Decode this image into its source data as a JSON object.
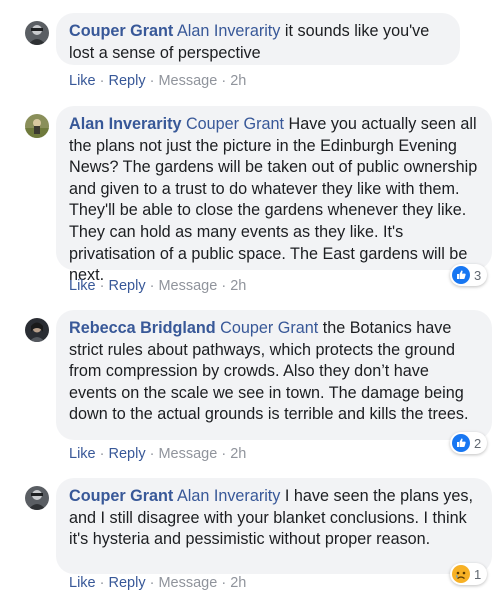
{
  "comments": [
    {
      "author": "Couper Grant",
      "mention": "Alan Inverarity",
      "text": " it sounds like you've lost a sense of perspective",
      "actions": {
        "like": "Like",
        "reply": "Reply",
        "message": "Message",
        "time": "2h"
      },
      "reaction_count": null
    },
    {
      "author": "Alan Inverarity",
      "mention": "Couper Grant",
      "text": " Have you actually seen all the plans not just the picture in the Edinburgh Evening News? The gardens will be taken out of public ownership and given to a trust to do whatever they like with them. They'll be able to close the gardens whenever they like. They can hold as many events as they like. It's privatisation of a public space. The East gardens will be next.",
      "actions": {
        "like": "Like",
        "reply": "Reply",
        "message": "Message",
        "time": "2h"
      },
      "reaction_icon": "like-icon",
      "reaction_count": "3"
    },
    {
      "author": "Rebecca Bridgland",
      "mention": "Couper Grant",
      "text": " the Botanics have strict rules about pathways, which protects the ground from compression by crowds. Also they don’t have events on the scale we see in town. The damage being down to the actual grounds is terrible and kills the trees.",
      "actions": {
        "like": "Like",
        "reply": "Reply",
        "message": "Message",
        "time": "2h"
      },
      "reaction_icon": "like-icon",
      "reaction_count": "2"
    },
    {
      "author": "Couper Grant",
      "mention": "Alan Inverarity",
      "text": " I have seen the plans yes, and I still disagree with your blanket conclusions. I think it's hysteria and pessimistic without proper reason.",
      "actions": {
        "like": "Like",
        "reply": "Reply",
        "message": "Message",
        "time": "2h"
      },
      "reaction_icon": "sad-icon",
      "reaction_count": "1"
    }
  ],
  "separator": " · ",
  "colors": {
    "link": "#385898",
    "meta": "#90949c",
    "bubble": "#f2f3f5",
    "like_blue": "#1877f2",
    "sad_yellow": "#f7b125"
  }
}
